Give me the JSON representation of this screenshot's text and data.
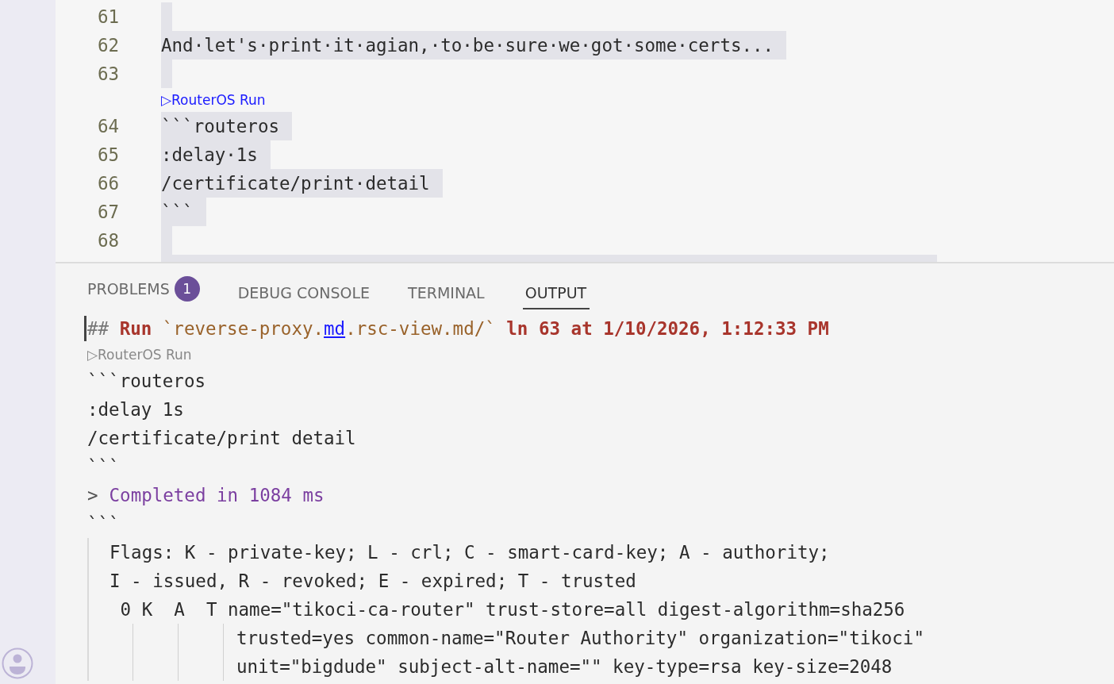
{
  "editor": {
    "lines": [
      {
        "kind": "code",
        "number": "61"
      },
      {
        "kind": "code",
        "number": "62",
        "text": "And·let's·print·it·agian,·to·be·sure·we·got·some·certs..."
      },
      {
        "kind": "code",
        "number": "63"
      },
      {
        "kind": "codelens",
        "text": "▷RouterOS Run"
      },
      {
        "kind": "code",
        "number": "64",
        "text": "```routeros"
      },
      {
        "kind": "code",
        "number": "65",
        "text": ":delay·1s"
      },
      {
        "kind": "code",
        "number": "66",
        "text": "/certificate/print·detail"
      },
      {
        "kind": "code",
        "number": "67",
        "text": "```"
      },
      {
        "kind": "code",
        "number": "68"
      }
    ]
  },
  "panel": {
    "tabs": [
      {
        "label": "PROBLEMS",
        "badge": "1",
        "selected": false
      },
      {
        "label": "DEBUG CONSOLE",
        "selected": false
      },
      {
        "label": "TERMINAL",
        "selected": false
      },
      {
        "label": "OUTPUT",
        "selected": true
      }
    ],
    "output": {
      "header": [
        {
          "kind": "hash",
          "text": "##"
        },
        {
          "kind": "keyword",
          "text": " Run "
        },
        {
          "kind": "path",
          "text": "`reverse-proxy."
        },
        {
          "kind": "link",
          "text": "md"
        },
        {
          "kind": "path",
          "text": ".rsc-view.md/`"
        },
        {
          "kind": "keyword",
          "text": " ln 63 at 1/10/2026, 1:12:33 PM"
        }
      ],
      "codelens": "▷RouterOS Run",
      "lines": [
        {
          "kind": "plain",
          "text": "```routeros"
        },
        {
          "kind": "plain",
          "text": ":delay 1s"
        },
        {
          "kind": "plain",
          "text": "/certificate/print detail"
        },
        {
          "kind": "plain",
          "text": "```"
        },
        {
          "kind": "completed",
          "prompt": ">",
          "text": "Completed in 1084 ms"
        },
        {
          "kind": "plain",
          "text": "```"
        }
      ],
      "result": [
        {
          "kind": "line",
          "text": "Flags: K - private-key; L - crl; C - smart-card-key; A - authority;"
        },
        {
          "kind": "line",
          "text": "I - issued, R - revoked; E - expired; T - trusted"
        },
        {
          "kind": "line",
          "text": " 0 K  A  T name=\"tikoci-ca-router\" trust-store=all digest-algorithm=sha256"
        },
        {
          "kind": "continuation",
          "text": "trusted=yes common-name=\"Router Authority\" organization=\"tikoci\""
        },
        {
          "kind": "continuation",
          "text": "unit=\"bigdude\" subject-alt-name=\"\" key-type=rsa key-size=2048"
        }
      ]
    }
  }
}
